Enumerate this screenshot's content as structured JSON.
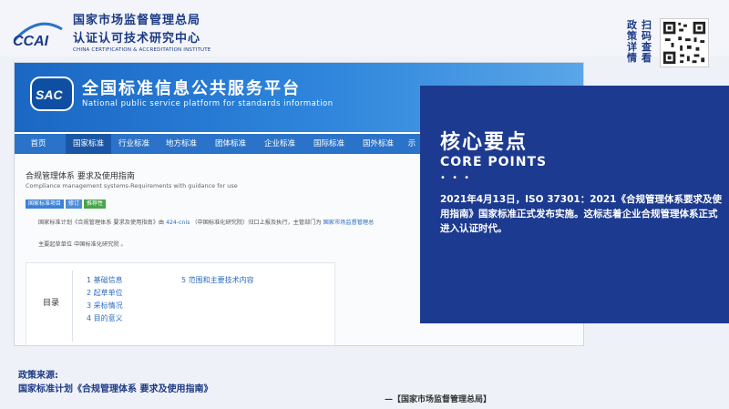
{
  "header": {
    "logo_abbr": "CCAI",
    "org_line1": "国家市场监督管理总局",
    "org_line2": "认证认可技术研究中心",
    "org_english": "CHINA CERTIFICATION & ACCREDITATION INSTITUTE",
    "scan_col1": "政策详情",
    "scan_col2": "扫码查看"
  },
  "portal": {
    "logo": "SAC",
    "title": "全国标准信息公共服务平台",
    "subtitle": "National public service platform  for standards information",
    "nav": [
      "首页",
      "国家标准",
      "行业标准",
      "地方标准",
      "团体标准",
      "企业标准",
      "国际标准",
      "国外标准",
      "示"
    ],
    "doc_title": "合规管理体系 要求及使用指南",
    "doc_subtitle": "Compliance management systems-Requirements with guidance for use",
    "tags": [
      "国家标准项目",
      "修订",
      "推荐性"
    ],
    "para1_a": "国家标准计划《合规管理体系 要求及使用指南》由",
    "para1_link1": "424-cnis",
    "para1_b": "（中国标准化研究院）归口上报及执行，主管部门为",
    "para1_link2": "国家市场监督管理总",
    "para2": "主要起草单位 中国标准化研究院 。",
    "toc_label": "目录",
    "toc": [
      "1  基础信息",
      "2  起草单位",
      "3  采标情况",
      "4  目的意义",
      "5  范围和主要技术内容"
    ]
  },
  "core": {
    "title": "核心要点",
    "subtitle": "CORE POINTS",
    "dots": "• • •",
    "body": "2021年4月13日，ISO 37301：2021《合规管理体系要求及使用指南》国家标准正式发布实施。这标志着企业合规管理体系正式进入认证时代。"
  },
  "footer": {
    "source_label": "政策来源:",
    "source_text": "国家标准计划《合规管理体系 要求及使用指南》",
    "org": "—【国家市场监督管理总局】"
  },
  "colors": {
    "brand_blue": "#1c3a8f",
    "portal_blue": "#2b73c8"
  }
}
